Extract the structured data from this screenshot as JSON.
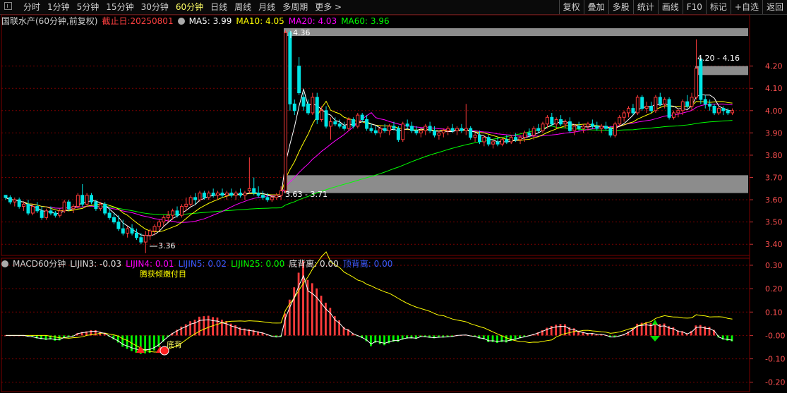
{
  "toolbar": {
    "periods": [
      "分时",
      "1分钟",
      "5分钟",
      "15分钟",
      "30分钟",
      "60分钟",
      "日线",
      "周线",
      "月线",
      "多周期",
      "更多 >"
    ],
    "active_period": "60分钟",
    "tools": [
      "复权",
      "叠加",
      "多股",
      "统计",
      "画线",
      "F10",
      "标记",
      "+自选",
      "返回"
    ]
  },
  "main_info": {
    "stock": "国联水产(60分钟,前复权)",
    "cutoff": "截止日:20250801",
    "ma5": "MA5: 3.99",
    "ma10": "MA10: 4.05",
    "ma20": "MA20: 4.03",
    "ma60": "MA60: 3.96"
  },
  "indicator_info": {
    "name": "MACD60分钟",
    "lijin3": "LIJIN3: -0.03",
    "lijin4": "LIJIN4: 0.01",
    "lijin5": "LIJIN5: 0.02",
    "lijin25": "LIJIN25: 0.00",
    "dbl": "底背离: 0.00",
    "dingbl": "顶背离: 0.00"
  },
  "colors": {
    "up": "#ff3b3b",
    "down": "#00e5e5",
    "ma5": "#ffffff",
    "ma10": "#ffff00",
    "ma20": "#ff00ff",
    "ma60": "#00ff00",
    "grid": "#7a0000",
    "zone": "#8c8c8c"
  },
  "price_axis": {
    "min": 3.35,
    "max": 4.37,
    "ticks": [
      "4.20",
      "4.10",
      "4.00",
      "3.90",
      "3.80",
      "3.70",
      "3.60",
      "3.50",
      "3.40"
    ]
  },
  "macd_axis": {
    "min": -0.24,
    "max": 0.33,
    "ticks": [
      "0.30",
      "0.20",
      "0.10",
      "-0.00",
      "-0.10",
      "-0.20"
    ]
  },
  "annotations": {
    "high_label": "4.36",
    "low_label": "3.36",
    "zone_low_label": "3.63 - 3.71",
    "zone_high_label": "4.20 - 4.16",
    "divergence_label": "底背",
    "buy_text": "腾获倾嫩付目"
  },
  "chart_data": {
    "type": "candlestick",
    "note_keys": "o,h,l,c per 60-minute bar",
    "candles": [
      [
        3.62,
        3.62,
        3.6,
        3.61
      ],
      [
        3.61,
        3.62,
        3.58,
        3.59
      ],
      [
        3.59,
        3.61,
        3.57,
        3.6
      ],
      [
        3.6,
        3.61,
        3.56,
        3.57
      ],
      [
        3.57,
        3.59,
        3.55,
        3.58
      ],
      [
        3.58,
        3.6,
        3.53,
        3.54
      ],
      [
        3.54,
        3.58,
        3.53,
        3.57
      ],
      [
        3.57,
        3.59,
        3.54,
        3.55
      ],
      [
        3.55,
        3.57,
        3.51,
        3.52
      ],
      [
        3.52,
        3.56,
        3.51,
        3.55
      ],
      [
        3.55,
        3.57,
        3.53,
        3.54
      ],
      [
        3.54,
        3.55,
        3.52,
        3.53
      ],
      [
        3.53,
        3.56,
        3.52,
        3.55
      ],
      [
        3.55,
        3.6,
        3.54,
        3.59
      ],
      [
        3.59,
        3.6,
        3.55,
        3.56
      ],
      [
        3.56,
        3.58,
        3.54,
        3.57
      ],
      [
        3.57,
        3.63,
        3.56,
        3.62
      ],
      [
        3.62,
        3.67,
        3.57,
        3.58
      ],
      [
        3.58,
        3.63,
        3.57,
        3.62
      ],
      [
        3.62,
        3.63,
        3.58,
        3.59
      ],
      [
        3.59,
        3.6,
        3.55,
        3.56
      ],
      [
        3.56,
        3.59,
        3.55,
        3.58
      ],
      [
        3.58,
        3.59,
        3.53,
        3.54
      ],
      [
        3.54,
        3.56,
        3.51,
        3.52
      ],
      [
        3.52,
        3.54,
        3.49,
        3.5
      ],
      [
        3.5,
        3.53,
        3.46,
        3.47
      ],
      [
        3.47,
        3.51,
        3.44,
        3.45
      ],
      [
        3.45,
        3.48,
        3.43,
        3.47
      ],
      [
        3.47,
        3.49,
        3.44,
        3.45
      ],
      [
        3.45,
        3.47,
        3.42,
        3.43
      ],
      [
        3.43,
        3.45,
        3.4,
        3.41
      ],
      [
        3.41,
        3.46,
        3.36,
        3.44
      ],
      [
        3.44,
        3.47,
        3.42,
        3.46
      ],
      [
        3.46,
        3.49,
        3.44,
        3.48
      ],
      [
        3.48,
        3.51,
        3.46,
        3.5
      ],
      [
        3.5,
        3.53,
        3.48,
        3.52
      ],
      [
        3.52,
        3.55,
        3.5,
        3.53
      ],
      [
        3.53,
        3.56,
        3.51,
        3.55
      ],
      [
        3.55,
        3.57,
        3.52,
        3.53
      ],
      [
        3.53,
        3.58,
        3.52,
        3.57
      ],
      [
        3.57,
        3.61,
        3.55,
        3.58
      ],
      [
        3.58,
        3.62,
        3.57,
        3.61
      ],
      [
        3.61,
        3.63,
        3.58,
        3.6
      ],
      [
        3.6,
        3.64,
        3.59,
        3.63
      ],
      [
        3.63,
        3.64,
        3.6,
        3.61
      ],
      [
        3.61,
        3.64,
        3.6,
        3.63
      ],
      [
        3.63,
        3.65,
        3.61,
        3.62
      ],
      [
        3.62,
        3.64,
        3.6,
        3.63
      ],
      [
        3.63,
        3.65,
        3.61,
        3.62
      ],
      [
        3.62,
        3.64,
        3.6,
        3.63
      ],
      [
        3.63,
        3.65,
        3.61,
        3.62
      ],
      [
        3.62,
        3.64,
        3.6,
        3.63
      ],
      [
        3.63,
        3.65,
        3.61,
        3.62
      ],
      [
        3.62,
        3.64,
        3.6,
        3.63
      ],
      [
        3.64,
        3.79,
        3.63,
        3.65
      ],
      [
        3.65,
        3.7,
        3.62,
        3.63
      ],
      [
        3.63,
        3.66,
        3.61,
        3.62
      ],
      [
        3.62,
        3.64,
        3.6,
        3.61
      ],
      [
        3.61,
        3.63,
        3.59,
        3.6
      ],
      [
        3.6,
        3.62,
        3.59,
        3.61
      ],
      [
        3.61,
        3.63,
        3.6,
        3.62
      ],
      [
        3.62,
        3.66,
        3.6,
        3.64
      ],
      [
        3.64,
        4.36,
        3.63,
        4.35
      ],
      [
        4.35,
        4.36,
        4.0,
        4.03
      ],
      [
        4.03,
        4.05,
        3.98,
        4.0
      ],
      [
        4.2,
        4.24,
        4.07,
        4.08
      ],
      [
        4.06,
        4.08,
        4.0,
        4.02
      ],
      [
        4.03,
        4.05,
        3.98,
        3.99
      ],
      [
        3.99,
        4.08,
        3.98,
        4.06
      ],
      [
        4.06,
        4.08,
        3.94,
        3.96
      ],
      [
        3.96,
        4.02,
        3.95,
        4.0
      ],
      [
        4.0,
        4.02,
        3.92,
        3.93
      ],
      [
        3.93,
        3.97,
        3.87,
        3.95
      ],
      [
        3.95,
        3.97,
        3.93,
        3.94
      ],
      [
        3.94,
        3.96,
        3.92,
        3.93
      ],
      [
        3.93,
        3.95,
        3.91,
        3.92
      ],
      [
        3.92,
        3.97,
        3.91,
        3.96
      ],
      [
        3.96,
        3.97,
        3.92,
        3.93
      ],
      [
        3.93,
        3.99,
        3.92,
        3.98
      ],
      [
        3.98,
        3.99,
        3.95,
        3.96
      ],
      [
        3.96,
        3.98,
        3.91,
        3.92
      ],
      [
        3.92,
        3.94,
        3.9,
        3.91
      ],
      [
        3.91,
        3.93,
        3.89,
        3.9
      ],
      [
        3.9,
        3.93,
        3.88,
        3.92
      ],
      [
        3.92,
        3.94,
        3.9,
        3.91
      ],
      [
        3.91,
        3.94,
        3.89,
        3.93
      ],
      [
        3.93,
        3.95,
        3.91,
        3.92
      ],
      [
        3.92,
        3.93,
        3.86,
        3.87
      ],
      [
        3.87,
        3.95,
        3.86,
        3.94
      ],
      [
        3.94,
        3.96,
        3.92,
        3.93
      ],
      [
        3.93,
        3.95,
        3.9,
        3.91
      ],
      [
        3.91,
        3.93,
        3.89,
        3.9
      ],
      [
        3.9,
        3.92,
        3.88,
        3.91
      ],
      [
        3.91,
        3.94,
        3.89,
        3.93
      ],
      [
        3.93,
        3.95,
        3.9,
        3.91
      ],
      [
        3.91,
        3.93,
        3.88,
        3.89
      ],
      [
        3.89,
        3.91,
        3.87,
        3.9
      ],
      [
        3.9,
        3.92,
        3.88,
        3.91
      ],
      [
        3.91,
        3.93,
        3.89,
        3.92
      ],
      [
        3.92,
        3.94,
        3.9,
        3.91
      ],
      [
        3.91,
        3.93,
        3.89,
        3.92
      ],
      [
        3.92,
        3.94,
        3.9,
        3.91
      ],
      [
        3.91,
        4.03,
        3.89,
        3.92
      ],
      [
        3.92,
        3.93,
        3.87,
        3.88
      ],
      [
        3.88,
        3.9,
        3.86,
        3.89
      ],
      [
        3.89,
        3.91,
        3.85,
        3.86
      ],
      [
        3.86,
        3.89,
        3.84,
        3.88
      ],
      [
        3.88,
        3.89,
        3.84,
        3.85
      ],
      [
        3.85,
        3.87,
        3.83,
        3.86
      ],
      [
        3.86,
        3.88,
        3.84,
        3.85
      ],
      [
        3.85,
        3.88,
        3.84,
        3.87
      ],
      [
        3.87,
        3.89,
        3.85,
        3.86
      ],
      [
        3.86,
        3.89,
        3.85,
        3.88
      ],
      [
        3.88,
        3.9,
        3.86,
        3.87
      ],
      [
        3.87,
        3.89,
        3.85,
        3.88
      ],
      [
        3.88,
        3.91,
        3.86,
        3.9
      ],
      [
        3.9,
        3.92,
        3.88,
        3.89
      ],
      [
        3.89,
        3.93,
        3.87,
        3.92
      ],
      [
        3.92,
        3.94,
        3.9,
        3.91
      ],
      [
        3.91,
        3.95,
        3.9,
        3.94
      ],
      [
        3.94,
        3.98,
        3.92,
        3.97
      ],
      [
        3.97,
        3.99,
        3.93,
        3.94
      ],
      [
        3.94,
        3.97,
        3.92,
        3.96
      ],
      [
        3.96,
        3.98,
        3.93,
        3.94
      ],
      [
        3.94,
        3.96,
        3.92,
        3.95
      ],
      [
        3.95,
        3.97,
        3.9,
        3.91
      ],
      [
        3.91,
        3.94,
        3.89,
        3.93
      ],
      [
        3.93,
        3.95,
        3.91,
        3.92
      ],
      [
        3.92,
        3.94,
        3.9,
        3.93
      ],
      [
        3.93,
        3.95,
        3.91,
        3.94
      ],
      [
        3.94,
        3.96,
        3.92,
        3.93
      ],
      [
        3.93,
        3.95,
        3.91,
        3.92
      ],
      [
        3.92,
        3.94,
        3.9,
        3.93
      ],
      [
        3.93,
        3.95,
        3.91,
        3.92
      ],
      [
        3.92,
        3.93,
        3.88,
        3.89
      ],
      [
        3.89,
        3.95,
        3.88,
        3.94
      ],
      [
        3.94,
        3.98,
        3.93,
        3.97
      ],
      [
        3.97,
        4.0,
        3.95,
        3.99
      ],
      [
        3.99,
        4.02,
        3.97,
        4.01
      ],
      [
        4.01,
        4.03,
        3.98,
        3.99
      ],
      [
        3.99,
        4.07,
        3.98,
        4.06
      ],
      [
        4.06,
        4.07,
        4.0,
        4.01
      ],
      [
        4.01,
        4.04,
        3.99,
        4.02
      ],
      [
        4.02,
        4.04,
        3.99,
        4.0
      ],
      [
        4.0,
        4.07,
        3.99,
        4.06
      ],
      [
        4.06,
        4.08,
        4.02,
        4.03
      ],
      [
        4.03,
        4.06,
        4.01,
        4.05
      ],
      [
        4.05,
        4.06,
        3.96,
        3.97
      ],
      [
        3.97,
        4.0,
        3.96,
        3.99
      ],
      [
        3.99,
        4.01,
        3.97,
        4.0
      ],
      [
        4.0,
        4.05,
        3.98,
        4.04
      ],
      [
        4.04,
        4.07,
        4.01,
        4.02
      ],
      [
        4.02,
        4.08,
        4.0,
        4.06
      ],
      [
        4.06,
        4.32,
        4.05,
        4.19
      ],
      [
        4.23,
        4.24,
        4.03,
        4.05
      ],
      [
        4.05,
        4.07,
        4.01,
        4.03
      ],
      [
        4.03,
        4.05,
        4.0,
        4.02
      ],
      [
        4.02,
        4.03,
        3.98,
        3.99
      ],
      [
        3.99,
        4.02,
        3.98,
        4.01
      ],
      [
        4.01,
        4.02,
        3.98,
        4.0
      ],
      [
        4.0,
        4.01,
        3.98,
        3.99
      ],
      [
        3.99,
        4.01,
        3.98,
        4.0
      ]
    ],
    "zones": [
      {
        "low": 3.63,
        "high": 3.71
      },
      {
        "low": 4.16,
        "high": 4.2
      },
      {
        "low": 4.335,
        "high": 4.37
      }
    ]
  }
}
